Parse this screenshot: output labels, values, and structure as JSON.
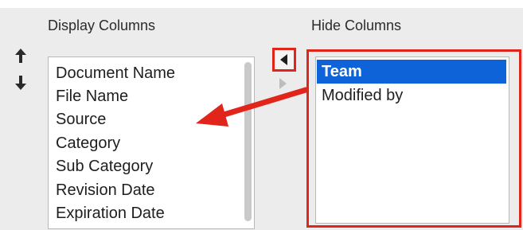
{
  "display_columns": {
    "heading": "Display Columns",
    "items": [
      "Document Name",
      "File Name",
      "Source",
      "Category",
      "Sub Category",
      "Revision Date",
      "Expiration Date"
    ]
  },
  "hide_columns": {
    "heading": "Hide Columns",
    "items": [
      {
        "label": "Team",
        "selected": true
      },
      {
        "label": "Modified by",
        "selected": false
      }
    ]
  },
  "icons": {
    "sort_up": "arrow-up-icon",
    "sort_down": "arrow-down-icon",
    "move_left": "triangle-left-icon"
  },
  "colors": {
    "highlight": "#e1251b",
    "selection": "#0f63d9"
  }
}
